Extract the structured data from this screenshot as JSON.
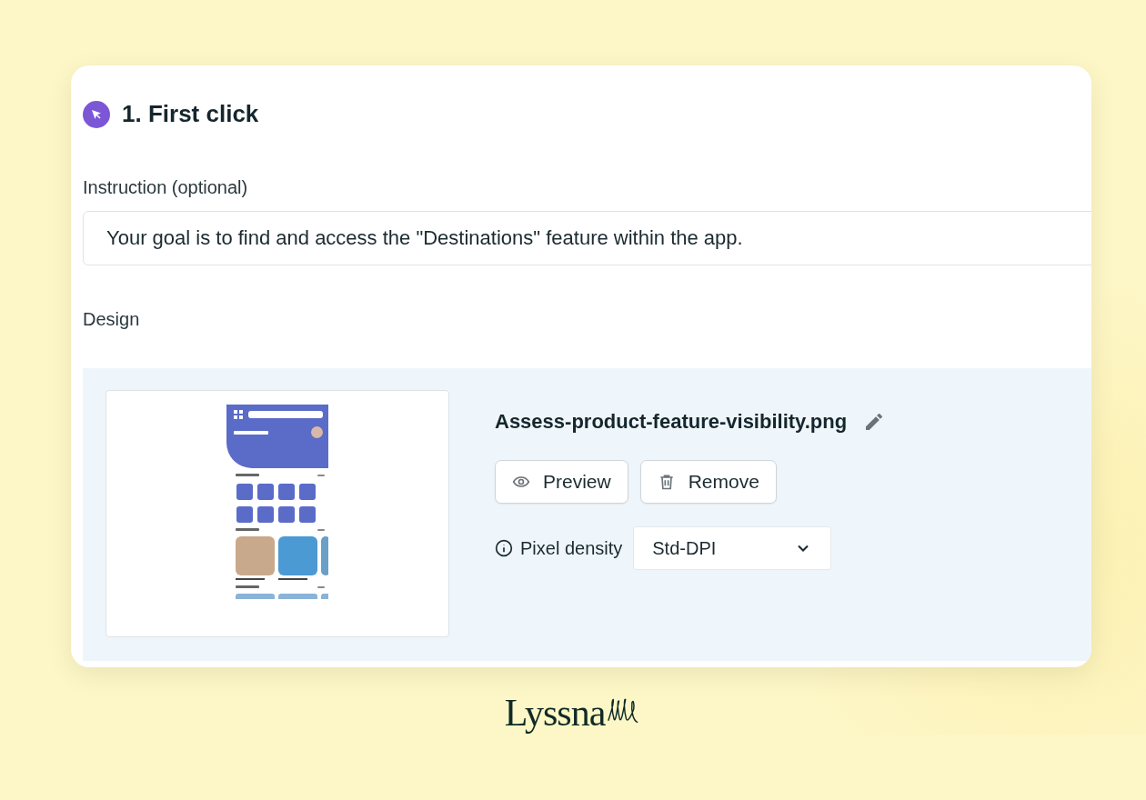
{
  "step": {
    "title": "1. First click"
  },
  "instruction": {
    "label": "Instruction (optional)",
    "value": "Your goal is to find and access the \"Destinations\" feature within the app."
  },
  "design": {
    "label": "Design",
    "file_name": "Assess-product-feature-visibility.png",
    "buttons": [
      {
        "label": "Preview",
        "kind": "preview"
      },
      {
        "label": "Remove",
        "kind": "remove"
      }
    ],
    "pixel_density": {
      "label": "Pixel density",
      "value": "Std-DPI"
    }
  },
  "brand": {
    "name": "Lyssna"
  }
}
